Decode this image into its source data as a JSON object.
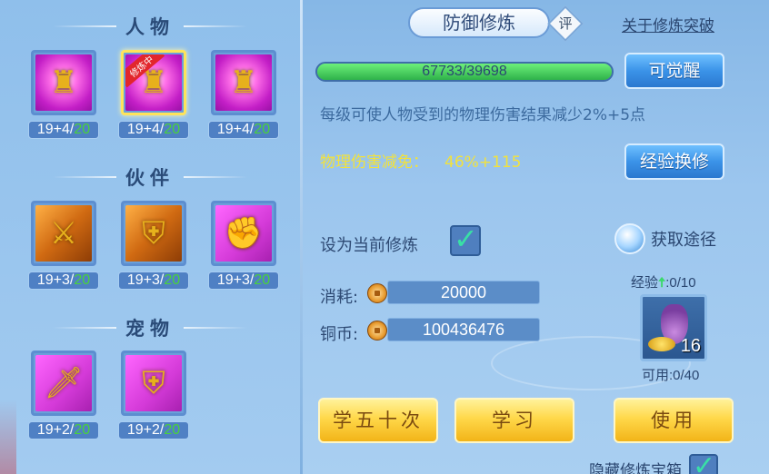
{
  "left": {
    "sections": [
      {
        "title": "人物",
        "skills": [
          {
            "icon": "golden-warrior-icon",
            "level": "19+4/",
            "max": "20",
            "selected": false,
            "badge": ""
          },
          {
            "icon": "golden-armor-icon",
            "level": "19+4/",
            "max": "20",
            "selected": true,
            "badge": "修炼中"
          },
          {
            "icon": "golden-defender-icon",
            "level": "19+4/",
            "max": "20",
            "selected": false,
            "badge": ""
          }
        ]
      },
      {
        "title": "伙伴",
        "skills": [
          {
            "icon": "sword-beast-icon",
            "level": "19+3/",
            "max": "20"
          },
          {
            "icon": "shield-beast-icon",
            "level": "19+3/",
            "max": "20"
          },
          {
            "icon": "gauntlet-beast-icon",
            "level": "19+3/",
            "max": "20"
          }
        ]
      },
      {
        "title": "宠物",
        "skills": [
          {
            "icon": "sword-cat-icon",
            "level": "19+2/",
            "max": "20"
          },
          {
            "icon": "shield-cat-icon",
            "level": "19+2/",
            "max": "20"
          }
        ]
      }
    ]
  },
  "right": {
    "title": "防御修炼",
    "rate_label": "评",
    "about_link": "关于修炼突破",
    "progress": {
      "text": "67733/39698",
      "fill_fraction": 1.0
    },
    "awaken_label": "可觉醒",
    "description": "每级可使人物受到的物理伤害结果减少2%+5点",
    "reduction_label": "物理伤害减免：",
    "reduction_value": "46%+115",
    "exchange_label": "经验换修",
    "set_current_label": "设为当前修炼",
    "get_route_label": "获取途径",
    "cost_label": "消耗:",
    "cost_value": "20000",
    "copper_label": "铜币:",
    "copper_value": "100436476",
    "exp_label": "经验",
    "exp_value": ":0/10",
    "item_count": "16",
    "available_label": "可用:0/40",
    "learn50_label": "学五十次",
    "learn_label": "学习",
    "use_label": "使用",
    "hide_label": "隐藏修炼宝箱"
  },
  "colors": {
    "accent_green": "#4ad23a",
    "reduction_yellow": "#f2e23c",
    "button_blue": "#3b93e8",
    "button_yellow": "#ffd84a"
  }
}
